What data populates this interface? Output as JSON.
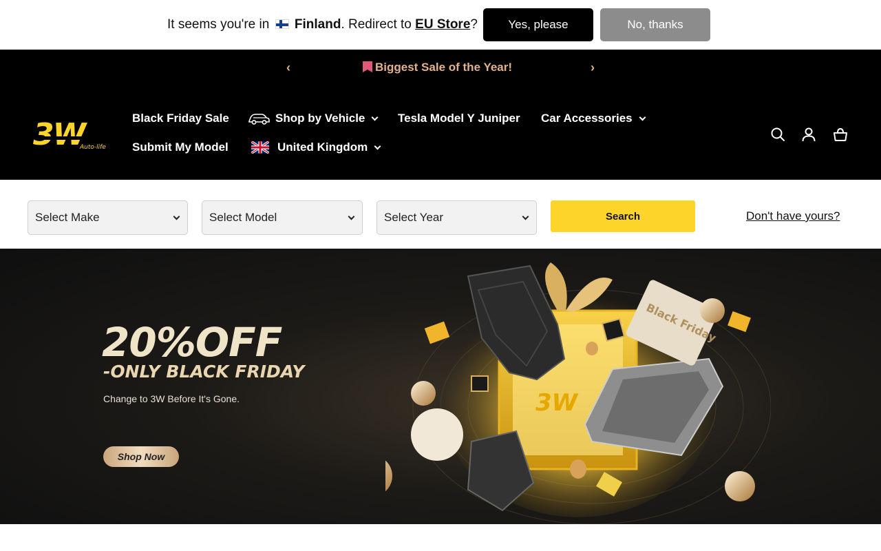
{
  "geo_bar": {
    "text_prefix": "It seems you're in",
    "country": "Finland",
    "text_middle": ". Redirect to",
    "store": "EU Store",
    "text_suffix": "?",
    "yes_label": "Yes, please",
    "no_label": "No, thanks"
  },
  "announcement": {
    "text": "Biggest Sale of the Year!",
    "prev_icon": "chevron-left-icon",
    "next_icon": "chevron-right-icon"
  },
  "header": {
    "logo_text": "3W",
    "logo_tagline": "Auto-life",
    "nav": [
      {
        "label": "Black Friday Sale"
      },
      {
        "label": "Shop by Vehicle",
        "icon": "car-icon",
        "dropdown": true
      },
      {
        "label": "Tesla Model Y Juniper"
      },
      {
        "label": "Car Accessories",
        "dropdown": true
      },
      {
        "label": "Submit My Model"
      },
      {
        "label": "United Kingdom",
        "icon": "uk-flag-icon",
        "dropdown": true
      }
    ],
    "icons": [
      "search-icon",
      "account-icon",
      "cart-icon"
    ]
  },
  "finder": {
    "make": "Select Make",
    "model": "Select Model",
    "year": "Select Year",
    "search_label": "Search",
    "dont_have": "Don't have yours?"
  },
  "hero": {
    "title": "20%OFF",
    "subtitle": "-ONLY BLACK FRIDAY",
    "description": "Change to 3W Before It's Gone.",
    "cta": "Shop Now",
    "art_brand": "3W",
    "art_ticket": "Black Friday"
  },
  "colors": {
    "accent_yellow": "#fdd52a",
    "announcement_text": "#e4b28a",
    "header_bg": "#000000",
    "gold": "#e9d6b0"
  }
}
